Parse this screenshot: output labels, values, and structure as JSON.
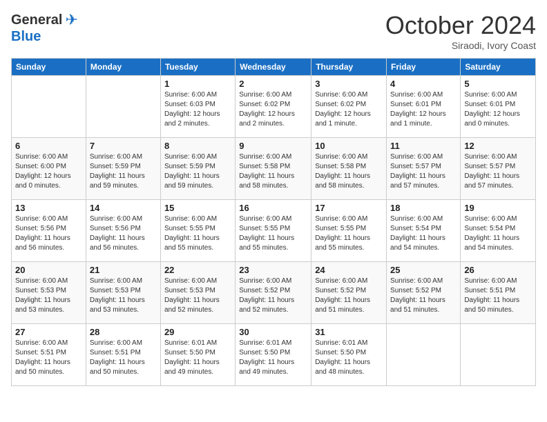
{
  "logo": {
    "general": "General",
    "blue": "Blue"
  },
  "title": "October 2024",
  "subtitle": "Siraodi, Ivory Coast",
  "weekdays": [
    "Sunday",
    "Monday",
    "Tuesday",
    "Wednesday",
    "Thursday",
    "Friday",
    "Saturday"
  ],
  "weeks": [
    [
      {
        "day": "",
        "info": ""
      },
      {
        "day": "",
        "info": ""
      },
      {
        "day": "1",
        "info": "Sunrise: 6:00 AM\nSunset: 6:03 PM\nDaylight: 12 hours and 2 minutes."
      },
      {
        "day": "2",
        "info": "Sunrise: 6:00 AM\nSunset: 6:02 PM\nDaylight: 12 hours and 2 minutes."
      },
      {
        "day": "3",
        "info": "Sunrise: 6:00 AM\nSunset: 6:02 PM\nDaylight: 12 hours and 1 minute."
      },
      {
        "day": "4",
        "info": "Sunrise: 6:00 AM\nSunset: 6:01 PM\nDaylight: 12 hours and 1 minute."
      },
      {
        "day": "5",
        "info": "Sunrise: 6:00 AM\nSunset: 6:01 PM\nDaylight: 12 hours and 0 minutes."
      }
    ],
    [
      {
        "day": "6",
        "info": "Sunrise: 6:00 AM\nSunset: 6:00 PM\nDaylight: 12 hours and 0 minutes."
      },
      {
        "day": "7",
        "info": "Sunrise: 6:00 AM\nSunset: 5:59 PM\nDaylight: 11 hours and 59 minutes."
      },
      {
        "day": "8",
        "info": "Sunrise: 6:00 AM\nSunset: 5:59 PM\nDaylight: 11 hours and 59 minutes."
      },
      {
        "day": "9",
        "info": "Sunrise: 6:00 AM\nSunset: 5:58 PM\nDaylight: 11 hours and 58 minutes."
      },
      {
        "day": "10",
        "info": "Sunrise: 6:00 AM\nSunset: 5:58 PM\nDaylight: 11 hours and 58 minutes."
      },
      {
        "day": "11",
        "info": "Sunrise: 6:00 AM\nSunset: 5:57 PM\nDaylight: 11 hours and 57 minutes."
      },
      {
        "day": "12",
        "info": "Sunrise: 6:00 AM\nSunset: 5:57 PM\nDaylight: 11 hours and 57 minutes."
      }
    ],
    [
      {
        "day": "13",
        "info": "Sunrise: 6:00 AM\nSunset: 5:56 PM\nDaylight: 11 hours and 56 minutes."
      },
      {
        "day": "14",
        "info": "Sunrise: 6:00 AM\nSunset: 5:56 PM\nDaylight: 11 hours and 56 minutes."
      },
      {
        "day": "15",
        "info": "Sunrise: 6:00 AM\nSunset: 5:55 PM\nDaylight: 11 hours and 55 minutes."
      },
      {
        "day": "16",
        "info": "Sunrise: 6:00 AM\nSunset: 5:55 PM\nDaylight: 11 hours and 55 minutes."
      },
      {
        "day": "17",
        "info": "Sunrise: 6:00 AM\nSunset: 5:55 PM\nDaylight: 11 hours and 55 minutes."
      },
      {
        "day": "18",
        "info": "Sunrise: 6:00 AM\nSunset: 5:54 PM\nDaylight: 11 hours and 54 minutes."
      },
      {
        "day": "19",
        "info": "Sunrise: 6:00 AM\nSunset: 5:54 PM\nDaylight: 11 hours and 54 minutes."
      }
    ],
    [
      {
        "day": "20",
        "info": "Sunrise: 6:00 AM\nSunset: 5:53 PM\nDaylight: 11 hours and 53 minutes."
      },
      {
        "day": "21",
        "info": "Sunrise: 6:00 AM\nSunset: 5:53 PM\nDaylight: 11 hours and 53 minutes."
      },
      {
        "day": "22",
        "info": "Sunrise: 6:00 AM\nSunset: 5:53 PM\nDaylight: 11 hours and 52 minutes."
      },
      {
        "day": "23",
        "info": "Sunrise: 6:00 AM\nSunset: 5:52 PM\nDaylight: 11 hours and 52 minutes."
      },
      {
        "day": "24",
        "info": "Sunrise: 6:00 AM\nSunset: 5:52 PM\nDaylight: 11 hours and 51 minutes."
      },
      {
        "day": "25",
        "info": "Sunrise: 6:00 AM\nSunset: 5:52 PM\nDaylight: 11 hours and 51 minutes."
      },
      {
        "day": "26",
        "info": "Sunrise: 6:00 AM\nSunset: 5:51 PM\nDaylight: 11 hours and 50 minutes."
      }
    ],
    [
      {
        "day": "27",
        "info": "Sunrise: 6:00 AM\nSunset: 5:51 PM\nDaylight: 11 hours and 50 minutes."
      },
      {
        "day": "28",
        "info": "Sunrise: 6:00 AM\nSunset: 5:51 PM\nDaylight: 11 hours and 50 minutes."
      },
      {
        "day": "29",
        "info": "Sunrise: 6:01 AM\nSunset: 5:50 PM\nDaylight: 11 hours and 49 minutes."
      },
      {
        "day": "30",
        "info": "Sunrise: 6:01 AM\nSunset: 5:50 PM\nDaylight: 11 hours and 49 minutes."
      },
      {
        "day": "31",
        "info": "Sunrise: 6:01 AM\nSunset: 5:50 PM\nDaylight: 11 hours and 48 minutes."
      },
      {
        "day": "",
        "info": ""
      },
      {
        "day": "",
        "info": ""
      }
    ]
  ]
}
